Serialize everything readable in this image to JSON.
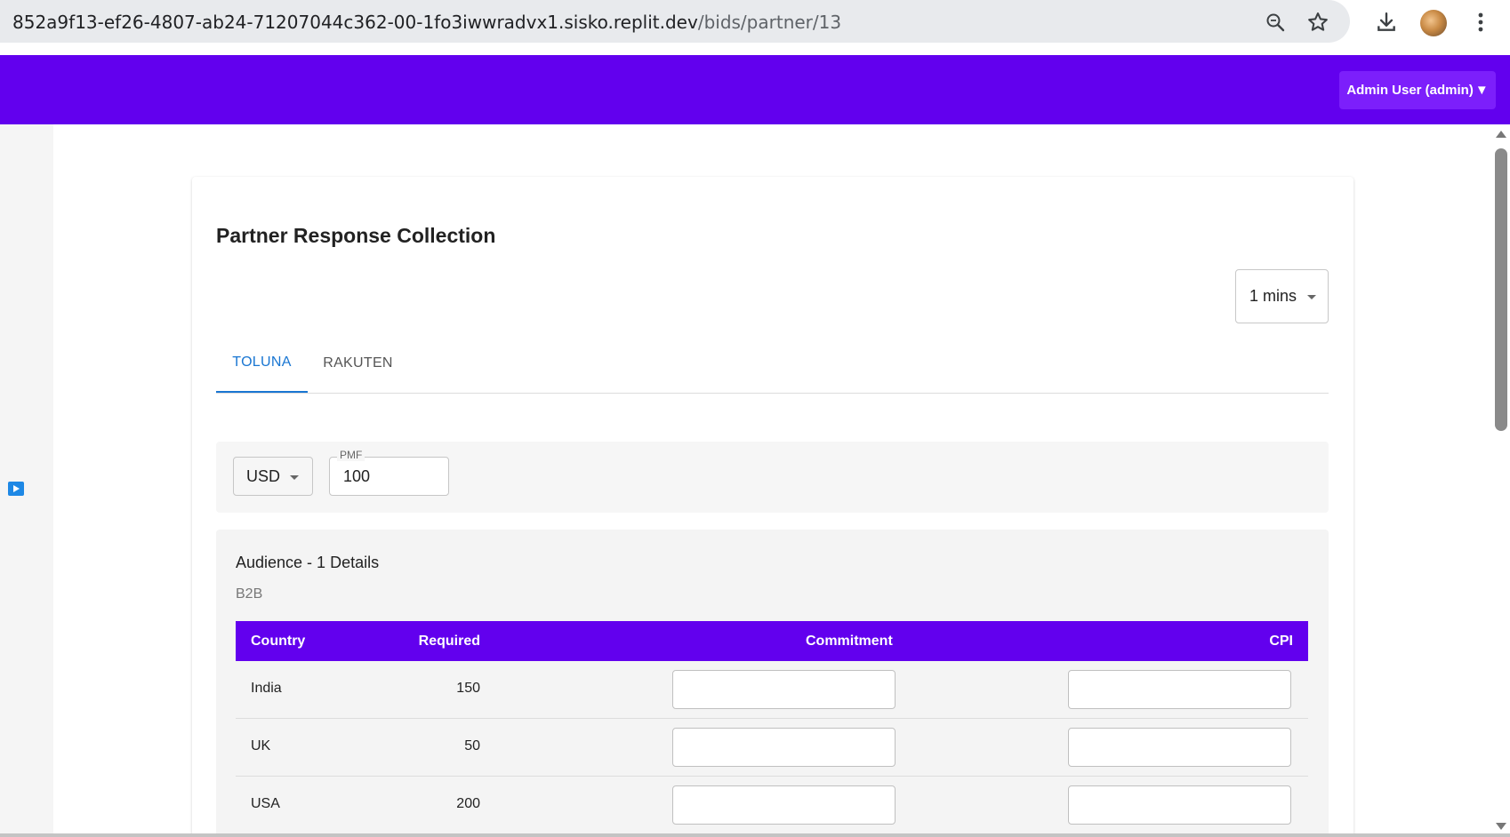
{
  "browser": {
    "url_host": "852a9f13-ef26-4807-ab24-71207044c362-00-1fo3iwwradvx1.sisko.replit.dev",
    "url_path": "/bids/partner/13"
  },
  "header": {
    "user_menu_label": "Admin User (admin)",
    "caret": "▼"
  },
  "page": {
    "title": "Partner Response Collection",
    "time_select_value": "1 mins",
    "tabs": [
      {
        "label": "TOLUNA",
        "active": true
      },
      {
        "label": "RAKUTEN",
        "active": false
      }
    ],
    "currency_value": "USD",
    "pmf_label": "PMF",
    "pmf_value": "100"
  },
  "audience": {
    "title": "Audience - 1 Details",
    "subtitle": "B2B",
    "columns": [
      "Country",
      "Required",
      "Commitment",
      "CPI"
    ],
    "rows": [
      {
        "country": "India",
        "required": "150",
        "commitment": "",
        "cpi": ""
      },
      {
        "country": "UK",
        "required": "50",
        "commitment": "",
        "cpi": ""
      },
      {
        "country": "USA",
        "required": "200",
        "commitment": "",
        "cpi": ""
      }
    ]
  },
  "colors": {
    "brand": "#6200ee",
    "tab_active": "#1976d2"
  }
}
